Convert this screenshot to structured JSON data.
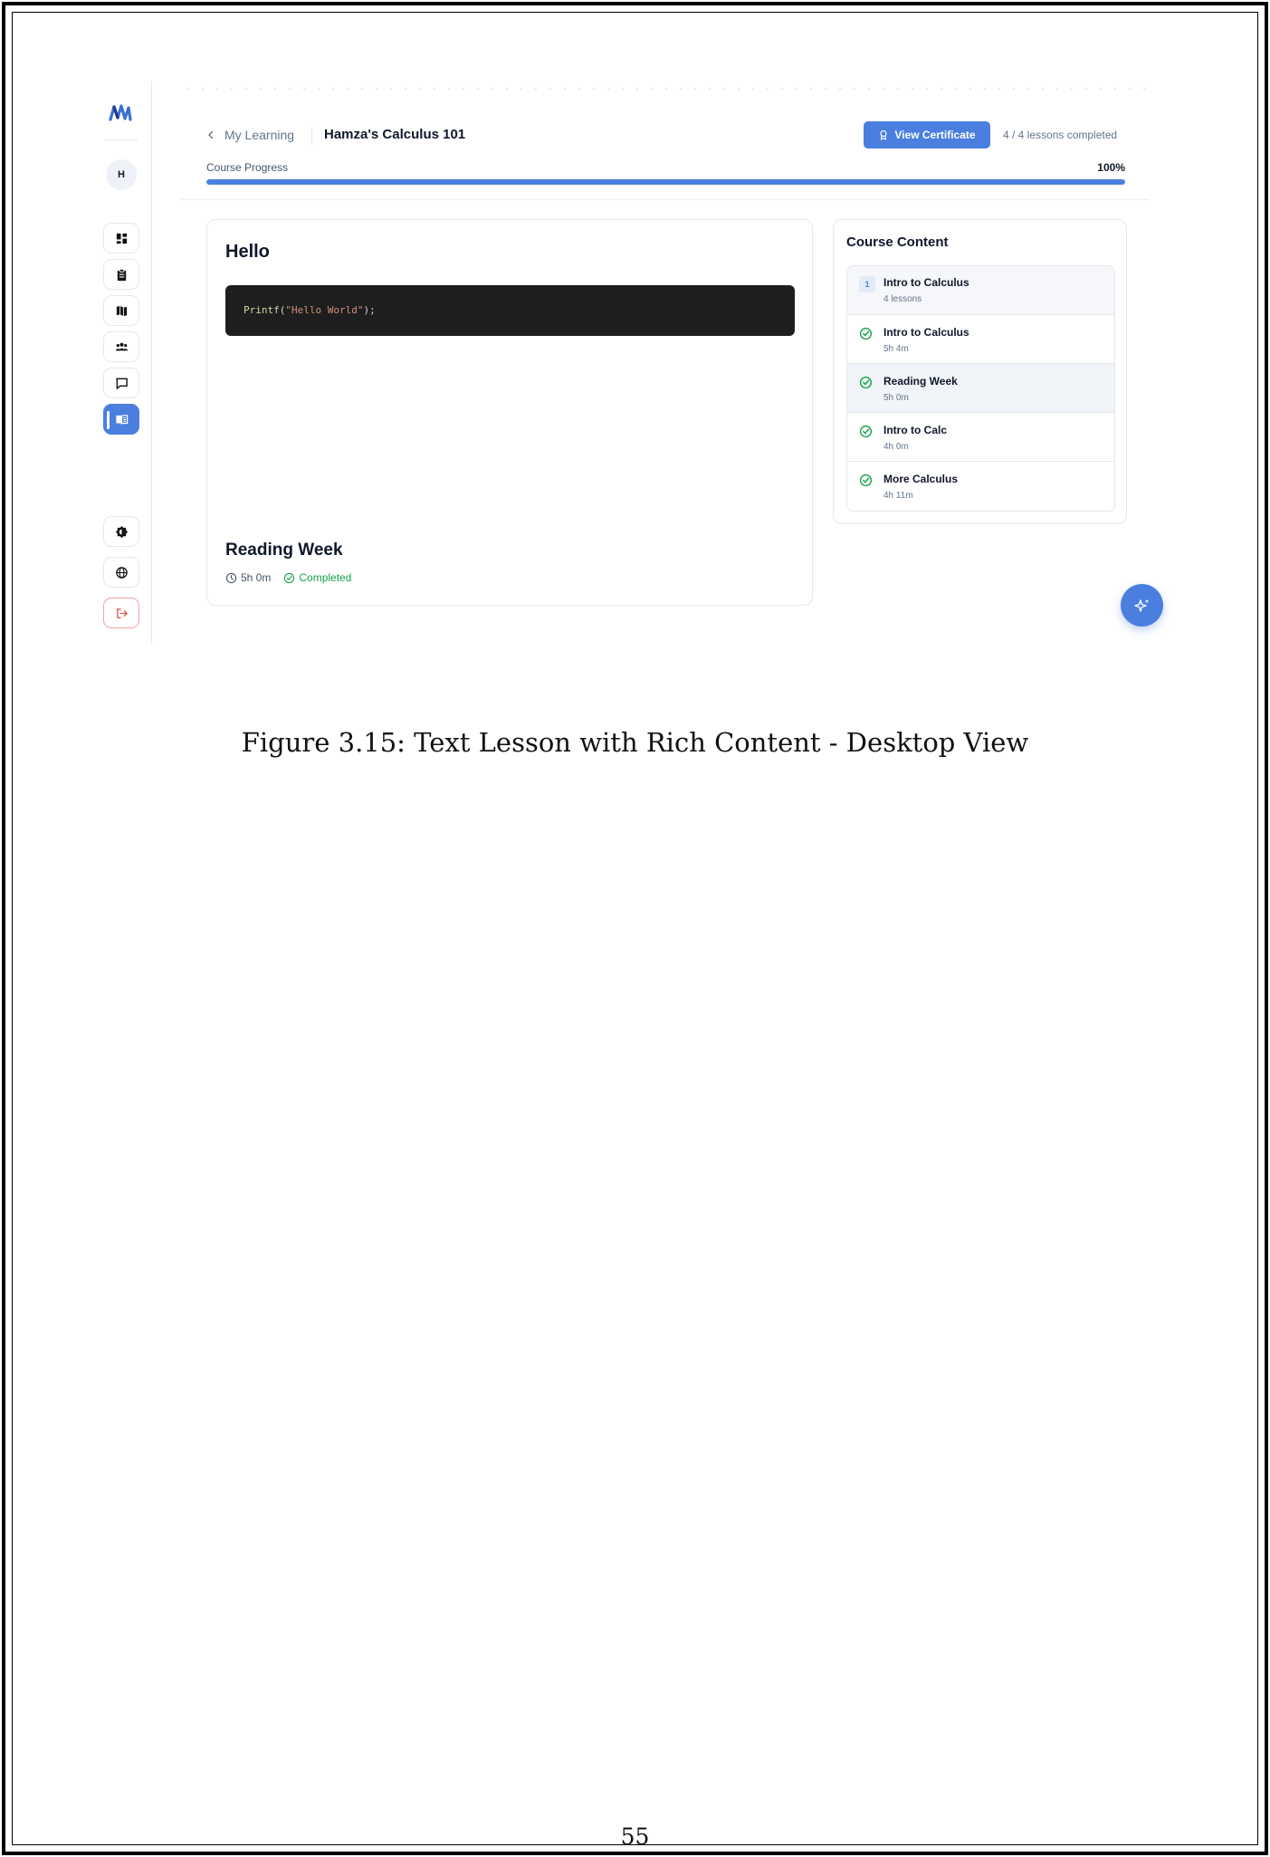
{
  "header": {
    "back_label": "My Learning",
    "course_title": "Hamza's Calculus 101",
    "certificate_label": "View Certificate",
    "lessons_completed": "4 / 4 lessons completed"
  },
  "progress": {
    "label": "Course Progress",
    "value_text": "100%",
    "fraction": 1.0
  },
  "sidebar": {
    "avatar_initial": "H",
    "items": [
      {
        "name": "dashboard-icon"
      },
      {
        "name": "clipboard-icon"
      },
      {
        "name": "map-icon"
      },
      {
        "name": "people-icon"
      },
      {
        "name": "chat-icon"
      },
      {
        "name": "book-icon",
        "active": true
      }
    ],
    "bottom_items": [
      {
        "name": "theme-icon"
      },
      {
        "name": "globe-icon"
      },
      {
        "name": "logout-icon"
      }
    ]
  },
  "lesson": {
    "heading": "Hello",
    "code": {
      "fn": "Printf",
      "open": "(",
      "string": "\"Hello World\"",
      "close": ");"
    },
    "title": "Reading Week",
    "duration": "5h 0m",
    "status": "Completed"
  },
  "course_content": {
    "title": "Course Content",
    "module": {
      "number": "1",
      "title": "Intro to Calculus",
      "subtitle": "4 lessons"
    },
    "lessons": [
      {
        "title": "Intro to Calculus",
        "duration": "5h 4m",
        "completed": true,
        "current": false
      },
      {
        "title": "Reading Week",
        "duration": "5h 0m",
        "completed": true,
        "current": true
      },
      {
        "title": "Intro to Calc",
        "duration": "4h 0m",
        "completed": true,
        "current": false
      },
      {
        "title": "More Calculus",
        "duration": "4h 11m",
        "completed": true,
        "current": false
      }
    ]
  },
  "colors": {
    "accent": "#4a7fe0",
    "success": "#16a34a",
    "danger": "#e05252"
  },
  "caption": "Figure 3.15: Text Lesson with Rich Content - Desktop View",
  "page_number": "55"
}
